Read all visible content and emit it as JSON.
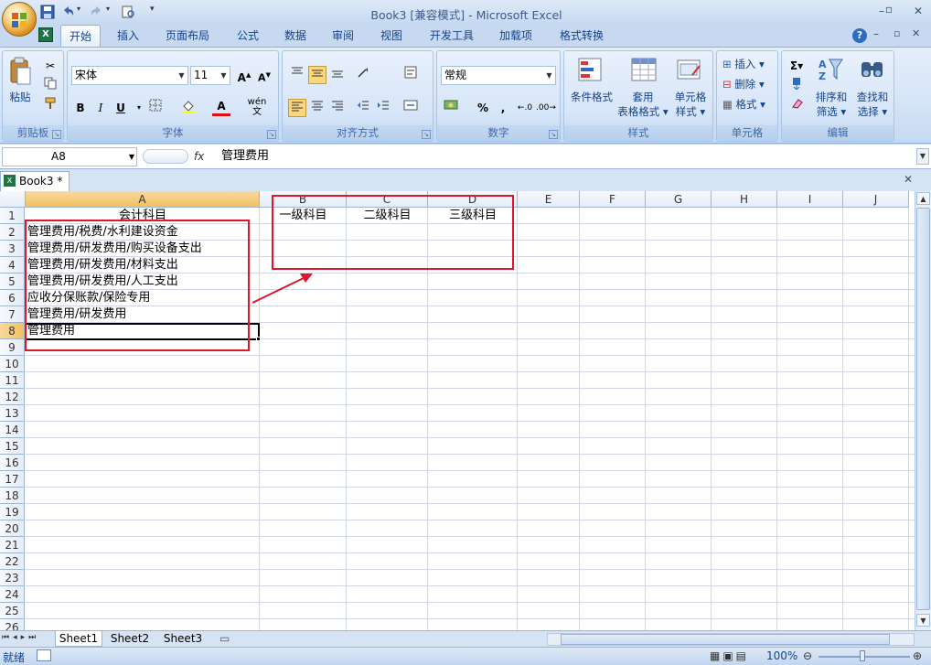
{
  "window": {
    "title": "Book3  [兼容模式] - Microsoft Excel"
  },
  "ribbon_tabs": [
    "开始",
    "插入",
    "页面布局",
    "公式",
    "数据",
    "审阅",
    "视图",
    "开发工具",
    "加载项",
    "格式转换"
  ],
  "clipboard": {
    "paste": "粘贴",
    "group": "剪贴板"
  },
  "font": {
    "name": "宋体",
    "size": "11",
    "bold": "B",
    "italic": "I",
    "underline": "U",
    "wen": "wén",
    "group": "字体"
  },
  "alignment": {
    "group": "对齐方式"
  },
  "number": {
    "format": "常规",
    "percent": "%",
    "comma": ",",
    "group": "数字"
  },
  "styles": {
    "conditional": "条件格式",
    "table_fmt_1": "套用",
    "table_fmt_2": "表格格式",
    "cell_styles_1": "单元格",
    "cell_styles_2": "样式",
    "group": "样式"
  },
  "cells": {
    "insert": "插入",
    "delete": "删除",
    "format": "格式",
    "group": "单元格"
  },
  "editing": {
    "sort_1": "排序和",
    "sort_2": "筛选",
    "find_1": "查找和",
    "find_2": "选择",
    "group": "编辑"
  },
  "formula_bar": {
    "name_box": "A8",
    "fx": "fx",
    "content": "管理费用"
  },
  "workbook_tab": "Book3 *",
  "columns": [
    "A",
    "B",
    "C",
    "D",
    "E",
    "F",
    "G",
    "H",
    "I",
    "J"
  ],
  "rows": [
    "1",
    "2",
    "3",
    "4",
    "5",
    "6",
    "7",
    "8",
    "9",
    "10",
    "11",
    "12",
    "13",
    "14",
    "15",
    "16",
    "17",
    "18",
    "19",
    "20",
    "21",
    "22",
    "23",
    "24",
    "25",
    "26"
  ],
  "cells_data": {
    "A1": "会计科目",
    "A2": "管理费用/税费/水利建设资金",
    "A3": "管理费用/研发费用/购买设备支出",
    "A4": "管理费用/研发费用/材料支出",
    "A5": "管理费用/研发费用/人工支出",
    "A6": "应收分保账款/保险专用",
    "A7": "管理费用/研发费用",
    "A8": "管理费用",
    "B1": "一级科目",
    "C1": "二级科目",
    "D1": "三级科目"
  },
  "sheets": [
    "Sheet1",
    "Sheet2",
    "Sheet3"
  ],
  "status": {
    "ready": "就绪",
    "zoom": "100%"
  },
  "colors": {
    "annotation": "#e0162b",
    "ribbon": "#c6d9f1",
    "selected_header": "#f1c15f"
  }
}
